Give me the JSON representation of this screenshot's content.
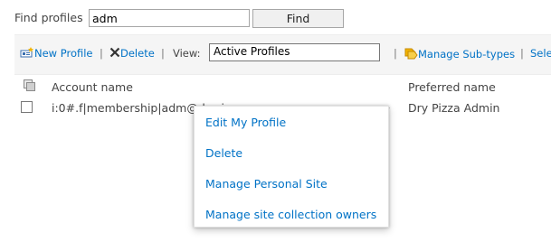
{
  "search": {
    "label": "Find profiles",
    "value": "adm",
    "button_label": "Find"
  },
  "toolbar": {
    "new_profile": "New Profile",
    "sep": "|",
    "delete": "Delete",
    "view_label": "View:",
    "view_selected": "Active Profiles",
    "manage_subtypes": "Manage Sub-types",
    "select_truncated": "Sele"
  },
  "table": {
    "headers": {
      "account": "Account name",
      "preferred": "Preferred name"
    },
    "rows": [
      {
        "account": "i:0#.f|membership|adm@dryrizza.com",
        "preferred": "Dry Pizza Admin"
      }
    ]
  },
  "context_menu": {
    "items": [
      "Edit My Profile",
      "Delete",
      "Manage Personal Site",
      "Manage site collection owners"
    ]
  },
  "colors": {
    "link": "#0072c6",
    "text": "#444444",
    "toolbar_bg": "#f5f5f5"
  }
}
